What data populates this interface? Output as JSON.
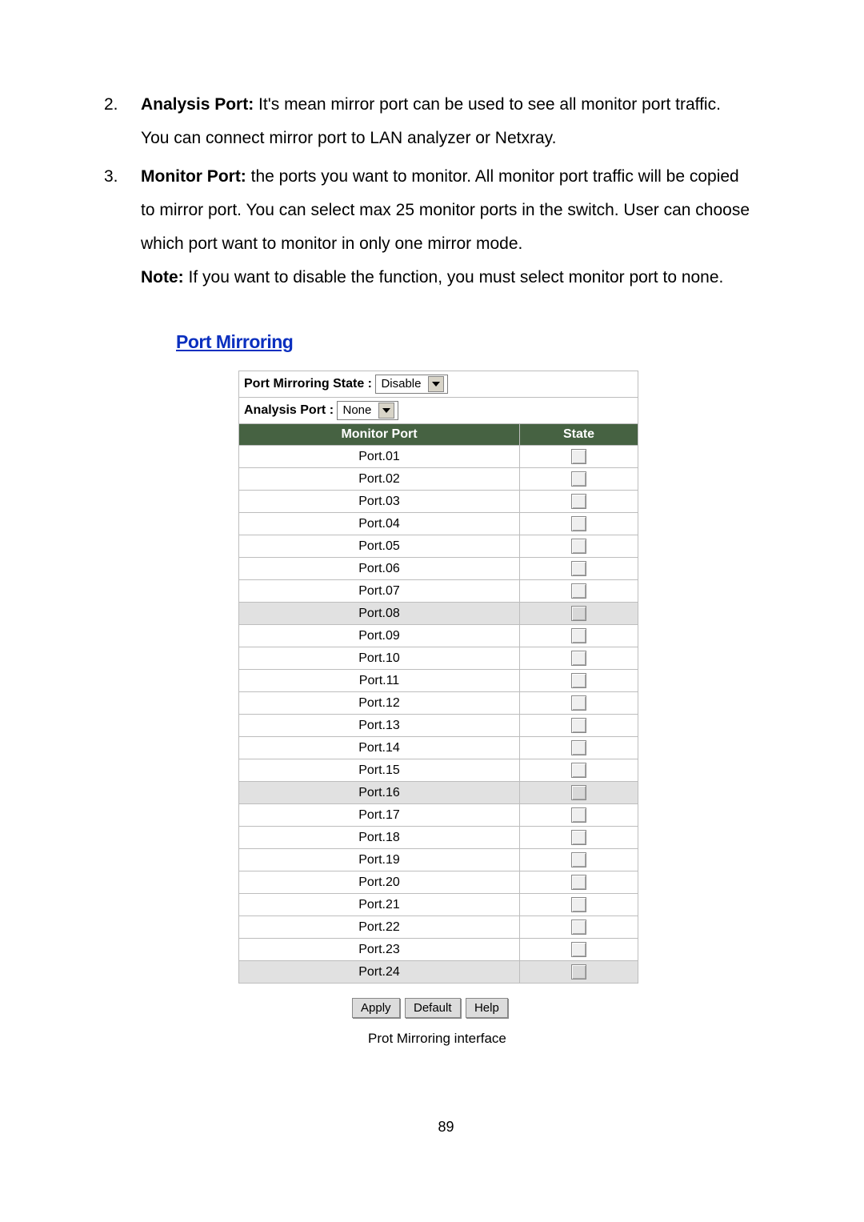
{
  "list": {
    "item2": {
      "num": "2.",
      "label": "Analysis Port:",
      "text_a": " It's mean mirror port can be used to see all monitor port traffic.",
      "line2": "You can connect mirror port to LAN analyzer or Netxray."
    },
    "item3": {
      "num": "3.",
      "label": "Monitor Port:",
      "text_a": " the ports you want to monitor. All monitor port traffic will be copied",
      "line2": "to mirror port. You can select max 25 monitor ports in the switch. User can choose",
      "line3": "which port want to monitor in only one mirror mode.",
      "note_label": "Note:",
      "note_text": " If you want to disable the function, you must select monitor port to none."
    }
  },
  "section_title": "Port Mirroring",
  "controls": {
    "state_label": "Port Mirroring State : ",
    "state_value": "Disable",
    "analysis_label": "Analysis Port : ",
    "analysis_value": "None"
  },
  "headers": {
    "monitor": "Monitor Port",
    "state": "State"
  },
  "ports": [
    "Port.01",
    "Port.02",
    "Port.03",
    "Port.04",
    "Port.05",
    "Port.06",
    "Port.07",
    "Port.08",
    "Port.09",
    "Port.10",
    "Port.11",
    "Port.12",
    "Port.13",
    "Port.14",
    "Port.15",
    "Port.16",
    "Port.17",
    "Port.18",
    "Port.19",
    "Port.20",
    "Port.21",
    "Port.22",
    "Port.23",
    "Port.24"
  ],
  "alt_rows": [
    7,
    15,
    23
  ],
  "buttons": {
    "apply": "Apply",
    "default": "Default",
    "help": "Help"
  },
  "caption": "Prot Mirroring interface",
  "page_number": "89"
}
